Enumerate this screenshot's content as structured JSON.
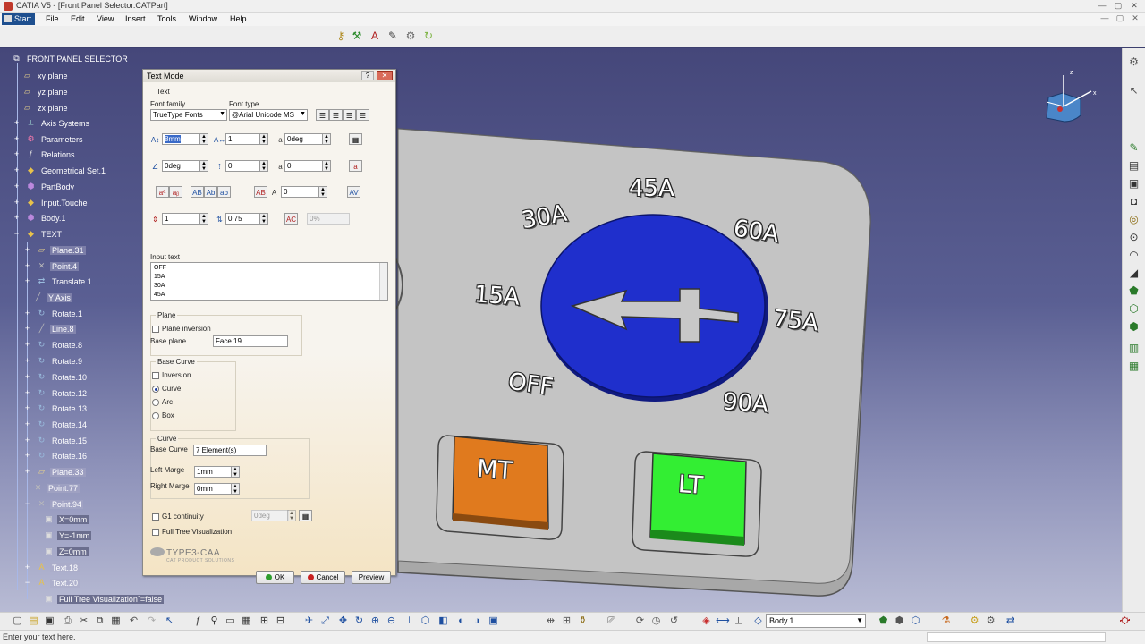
{
  "app": {
    "title": "CATIA V5 - [Front Panel Selector.CATPart]",
    "window_controls": [
      "—",
      "▢",
      "✕"
    ],
    "mdi_controls": [
      "—",
      "▢",
      "✕"
    ]
  },
  "menu": {
    "items": [
      "Start",
      "File",
      "Edit",
      "View",
      "Insert",
      "Tools",
      "Window",
      "Help"
    ]
  },
  "tree": {
    "root": "FRONT PANEL SELECTOR",
    "nodes": [
      {
        "label": "xy plane"
      },
      {
        "label": "yz plane"
      },
      {
        "label": "zx plane"
      },
      {
        "label": "Axis Systems"
      },
      {
        "label": "Parameters"
      },
      {
        "label": "Relations"
      },
      {
        "label": "Geometrical Set.1"
      },
      {
        "label": "PartBody"
      },
      {
        "label": "Input.Touche"
      },
      {
        "label": "Body.1"
      },
      {
        "label": "TEXT"
      },
      {
        "label": "Plane.31"
      },
      {
        "label": "Point.4"
      },
      {
        "label": "Translate.1"
      },
      {
        "label": "Y Axis"
      },
      {
        "label": "Rotate.1"
      },
      {
        "label": "Line.8"
      },
      {
        "label": "Rotate.8"
      },
      {
        "label": "Rotate.9"
      },
      {
        "label": "Rotate.10"
      },
      {
        "label": "Rotate.12"
      },
      {
        "label": "Rotate.13"
      },
      {
        "label": "Rotate.14"
      },
      {
        "label": "Rotate.15"
      },
      {
        "label": "Rotate.16"
      },
      {
        "label": "Plane.33"
      },
      {
        "label": "Point.77"
      },
      {
        "label": "Point.94"
      },
      {
        "label": "X=0mm"
      },
      {
        "label": "Y=-1mm"
      },
      {
        "label": "Z=0mm"
      },
      {
        "label": "Text.18"
      },
      {
        "label": "Text.20"
      },
      {
        "label": "Full Tree Visualization`=false"
      }
    ]
  },
  "dialog": {
    "title": "Text Mode",
    "help": "?",
    "close": "✕",
    "text_group": "Text",
    "font_family_label": "Font family",
    "font_family_value": "TrueType Fonts",
    "font_type_label": "Font type",
    "font_type_value": "@Arial Unicode MS",
    "height_value": "8mm",
    "ratio_value": "1",
    "slant_value": "0deg",
    "angle_value": "0deg",
    "offset1_value": "0",
    "offset2_value": "0",
    "spacing_value": "0",
    "line_value": "1",
    "factor_value": "0.75",
    "percent_value": "0%",
    "input_text_label": "Input text",
    "input_text_lines": [
      "OFF",
      "15A",
      "30A",
      "45A"
    ],
    "plane_group": "Plane",
    "plane_inversion": "Plane inversion",
    "base_plane_label": "Base plane",
    "base_plane_value": "Face.19",
    "base_curve_group": "Base Curve",
    "bc_inversion": "Inversion",
    "bc_curve": "Curve",
    "bc_arc": "Arc",
    "bc_box": "Box",
    "curve_group": "Curve",
    "base_curve_label": "Base Curve",
    "base_curve_value": "7 Element(s)",
    "left_marge_label": "Left Marge",
    "left_marge_value": "1mm",
    "right_marge_label": "Right Marge",
    "right_marge_value": "0mm",
    "g1_label": "G1 continuity",
    "g1_value": "0deg",
    "full_tree_label": "Full Tree Visualization",
    "logo": "TYPE3-CAA",
    "logo_sub": "CAT PRODUCT SOLUTIONS",
    "ok": "OK",
    "cancel": "Cancel",
    "preview": "Preview"
  },
  "model": {
    "dial_labels": [
      "OFF",
      "15A",
      "30A",
      "45A",
      "60A",
      "75A",
      "90A"
    ],
    "button_mt": "MT",
    "button_lt": "LT"
  },
  "bottom_toolbar": {
    "body_combo": "Body.1"
  },
  "status": {
    "message": "Enter your text here."
  },
  "colors": {
    "dial": "#1f2fcc",
    "button_mt": "#e07a1e",
    "button_lt": "#33ee33",
    "panel": "#c0c0c0",
    "viewport_top": "#45477a"
  }
}
